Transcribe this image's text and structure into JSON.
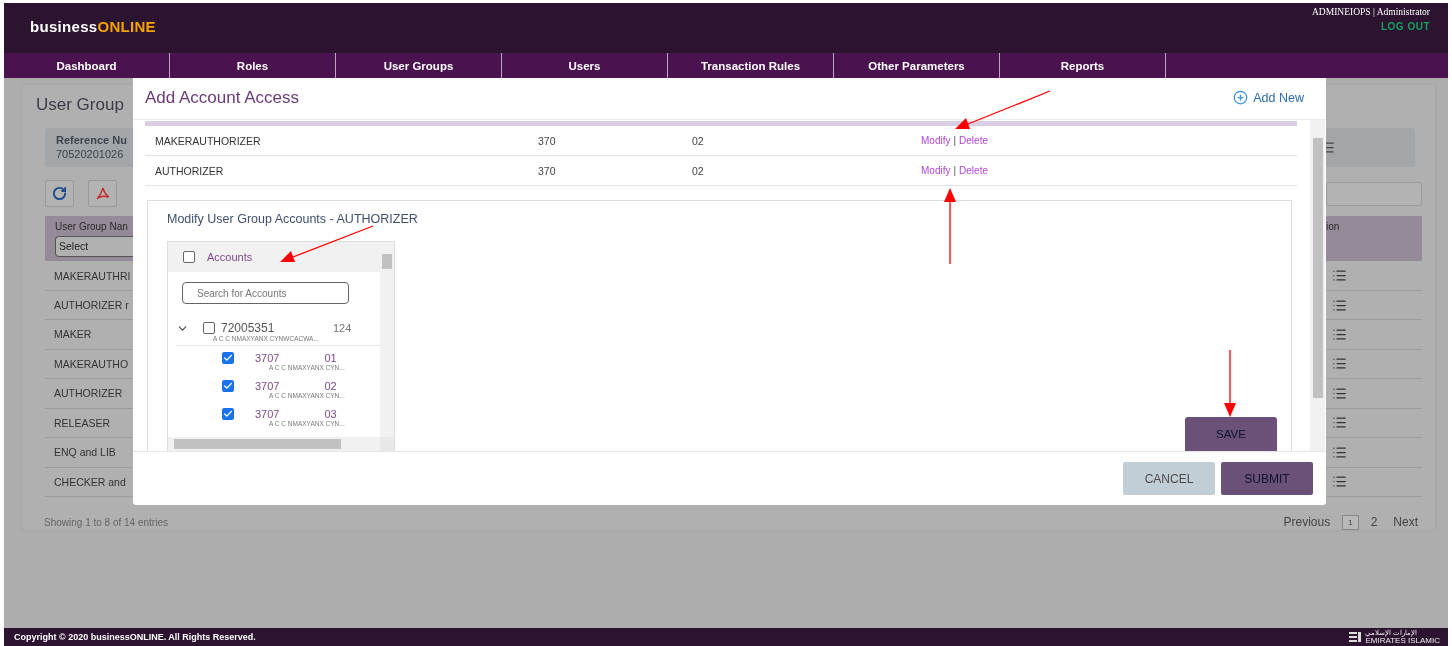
{
  "header": {
    "logo": {
      "prefix": "business",
      "accent": "ONLINE"
    },
    "user": "ADMINEIOPS",
    "separator": "|",
    "role": "Administrator",
    "logout": "LOG OUT"
  },
  "nav": [
    "Dashboard",
    "Roles",
    "User Groups",
    "Users",
    "Transaction Rules",
    "Other Parameters",
    "Reports"
  ],
  "page": {
    "title": "User Group",
    "reference": {
      "label": "Reference Nu",
      "value": "70520201026"
    },
    "table": {
      "columns": [
        {
          "label": "User Group Nan",
          "filter": "Select"
        },
        {
          "label": "ion"
        }
      ],
      "rows": [
        "MAKERAUTHRI",
        "AUTHORIZER r",
        "MAKER",
        "MAKERAUTHO",
        "AUTHORIZER",
        "RELEASER",
        "ENQ and LIB",
        "CHECKER and"
      ]
    },
    "summary": "Showing 1 to 8 of 14 entries",
    "pagination": {
      "previous": "Previous",
      "pages": [
        {
          "label": "1",
          "selected": true
        },
        {
          "label": "2",
          "selected": false
        }
      ],
      "next": "Next"
    }
  },
  "dialog": {
    "title": "Add Account Access",
    "add_new": "Add New",
    "rows": [
      {
        "name": "MAKERAUTHORIZER",
        "column_2": "370",
        "column_3": "02",
        "modify": "Modify",
        "separator": "|",
        "delete": "Delete"
      },
      {
        "name": "AUTHORIZER",
        "column_2": "370",
        "column_3": "02",
        "modify": "Modify",
        "separator": "|",
        "delete": "Delete"
      }
    ],
    "editor": {
      "title": "Modify User Group Accounts - AUTHORIZER",
      "tree": {
        "header": {
          "label": "Accounts",
          "checked": false
        },
        "search_placeholder": "Search for Accounts",
        "groups": [
          {
            "number": "72005351",
            "count": "124",
            "description": "A C C NMAXYANX CYNWCACWA...",
            "checked": false,
            "expanded": true,
            "children": [
              {
                "prefix": "3707",
                "suffix": "01",
                "description": "A C C NMAXYANX CYN...",
                "checked": true
              },
              {
                "prefix": "3707",
                "suffix": "02",
                "description": "A C C NMAXYANX CYN...",
                "checked": true
              },
              {
                "prefix": "3707",
                "suffix": "03",
                "description": "A C C NMAXYANX CYN...",
                "checked": true
              }
            ]
          }
        ]
      },
      "save": "SAVE"
    },
    "buttons": {
      "cancel": "CANCEL",
      "submit": "SUBMIT"
    }
  },
  "footer": {
    "copyright": "Copyright © 2020 businessONLINE. All Rights Reserved.",
    "logo_arabic": "الإمارات الإسلامي",
    "logo_english": "EMIRATES ISLAMIC"
  }
}
